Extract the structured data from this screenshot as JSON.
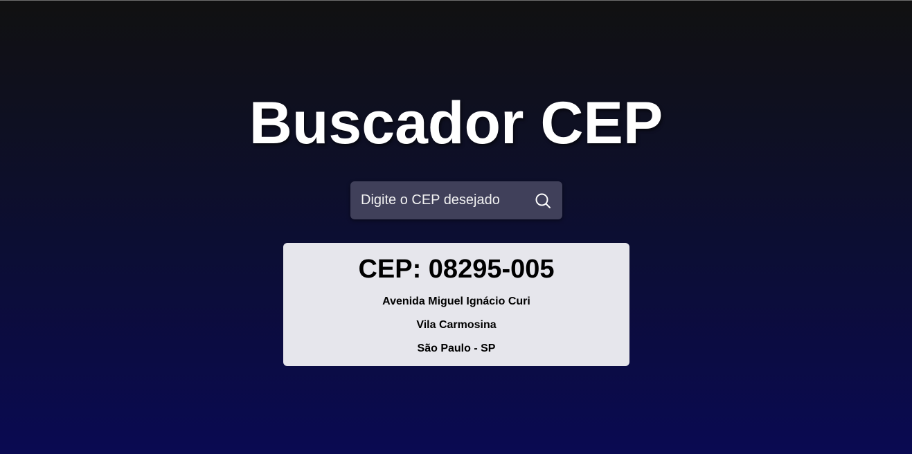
{
  "page": {
    "title": "Buscador CEP"
  },
  "search": {
    "placeholder": "Digite o CEP desejado",
    "value": "",
    "button_icon": "search-icon"
  },
  "result": {
    "cep_label": "CEP: 08295-005",
    "street": "Avenida Miguel Ignácio Curi",
    "district": "Vila Carmosina",
    "city_state": "São Paulo - SP"
  },
  "colors": {
    "background_top": "#111111",
    "background_bottom": "#0a0a52",
    "search_box": "#40405a",
    "card": "#e6e6ec",
    "title_text": "#ffffff"
  }
}
